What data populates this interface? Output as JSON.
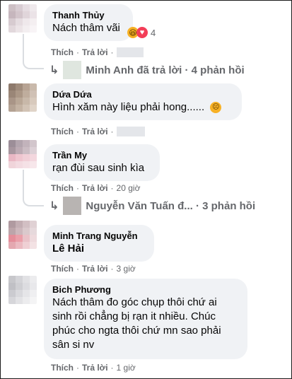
{
  "labels": {
    "like": "Thích",
    "reply": "Trả lời",
    "sep": "·"
  },
  "comments": [
    {
      "author": "Thanh Thủy",
      "text": "Nách thâm vãi",
      "reaction_count": "4",
      "time": "",
      "reply_summary": {
        "name": "Minh Anh",
        "text": "Minh Anh đã trả lời · 4 phản hồi"
      }
    },
    {
      "author": "Dứa Dứa",
      "text": "Hình xăm này liệu phải hong......",
      "time": ""
    },
    {
      "author": "Trần My",
      "text": "rạn đùi sau sinh kìa",
      "time": "20 giờ",
      "reply_summary": {
        "name": "Nguyễn Văn Tuấn đ...",
        "text": "Nguyễn Văn Tuấn đ... · 3 phản hồi"
      }
    },
    {
      "author": "Minh Trang Nguyễn",
      "text": "Lê Hải",
      "time": "3 giờ"
    },
    {
      "author": "Bich Phương",
      "text_lines": [
        "Nách thâm đo góc chụp thôi chứ ai",
        "sinh rồi chẳng bị rạn it nhiều. Chúc",
        "phúc cho ngta thôi chứ mn sao phải",
        "sân si nv"
      ],
      "time": "1 giờ"
    }
  ],
  "colors": {
    "bubble": "#f0f2f5",
    "meta": "#65676b",
    "haha": "#f7b125",
    "love": "#f33e58"
  },
  "icons": {
    "reply_arrow": "reply-arrow-icon",
    "haha": "haha-reaction-icon",
    "love": "love-reaction-icon",
    "sad": "sad-emoji-icon"
  }
}
